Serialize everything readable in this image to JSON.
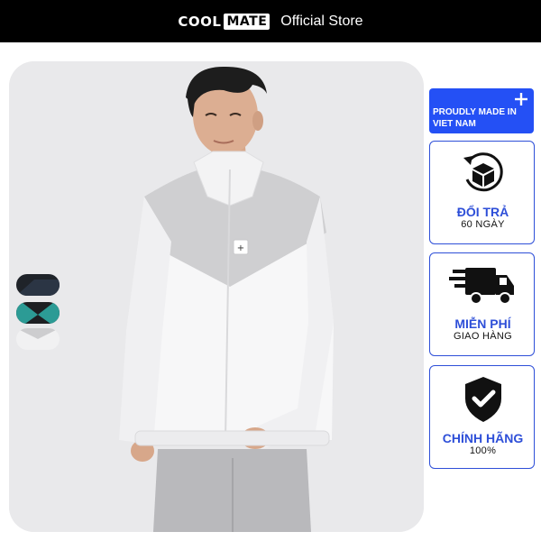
{
  "header": {
    "logo_part1": "COOL",
    "logo_part2": "MATE",
    "store_label": "Official Store"
  },
  "badge": {
    "text": "PROUDLY MADE IN VIET NAM"
  },
  "features": [
    {
      "title": "ĐỔI TRẢ",
      "subtitle": "60 NGÀY",
      "icon": "box-return-icon"
    },
    {
      "title": "MIỄN PHÍ",
      "subtitle": "GIAO HÀNG",
      "icon": "delivery-truck-icon"
    },
    {
      "title": "CHÍNH HÃNG",
      "subtitle": "100%",
      "icon": "shield-check-icon"
    }
  ],
  "color_options": [
    "black-navy",
    "black-teal",
    "white-gray"
  ],
  "colors": {
    "accent": "#2e4fd8",
    "badge_bg": "#2450f5",
    "header_bg": "#000000"
  }
}
